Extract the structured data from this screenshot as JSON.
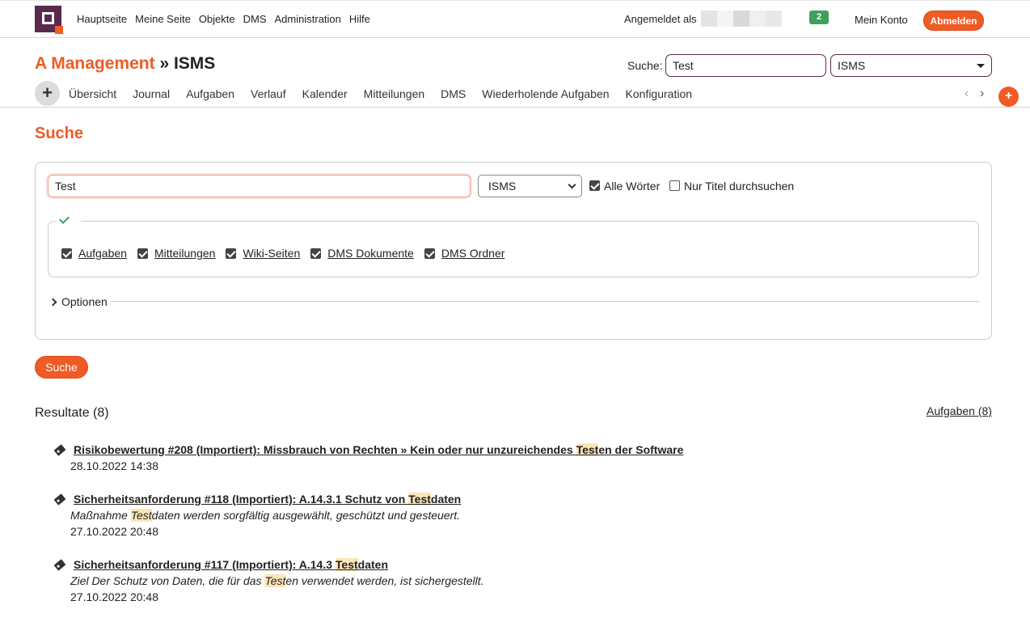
{
  "topbar": {
    "nav": [
      "Hauptseite",
      "Meine Seite",
      "Objekte",
      "DMS",
      "Administration",
      "Hilfe"
    ],
    "logged_in_label": "Angemeldet als",
    "badge_count": "2",
    "account_label": "Mein Konto",
    "logout_label": "Abmelden"
  },
  "header": {
    "project": "A Management",
    "separator": "»",
    "subproject": "ISMS",
    "search_label": "Suche:",
    "search_value": "Test",
    "scope_value": "ISMS"
  },
  "tabs": [
    "Übersicht",
    "Journal",
    "Aufgaben",
    "Verlauf",
    "Kalender",
    "Mitteilungen",
    "DMS",
    "Wiederholende Aufgaben",
    "Konfiguration"
  ],
  "page": {
    "title": "Suche",
    "query": "Test",
    "scope": "ISMS",
    "all_words_label": "Alle Wörter",
    "all_words_checked": true,
    "titles_only_label": "Nur Titel durchsuchen",
    "titles_only_checked": false,
    "types": [
      {
        "label": "Aufgaben",
        "checked": true
      },
      {
        "label": "Mitteilungen",
        "checked": true
      },
      {
        "label": "Wiki-Seiten",
        "checked": true
      },
      {
        "label": "DMS Dokumente",
        "checked": true
      },
      {
        "label": "DMS Ordner",
        "checked": true
      }
    ],
    "options_label": "Optionen",
    "search_button": "Suche"
  },
  "results": {
    "heading": "Resultate (8)",
    "filter_link": "Aufgaben (8)",
    "items": [
      {
        "title_pre": "Risikobewertung #208 (Importiert): Missbrauch von Rechten » Kein oder nur unzureichendes ",
        "title_hl": "Test",
        "title_post": "en der Software",
        "desc_pre": "",
        "desc_hl": "",
        "desc_post": "",
        "date": "28.10.2022 14:38"
      },
      {
        "title_pre": "Sicherheitsanforderung #118 (Importiert): A.14.3.1 Schutz von ",
        "title_hl": "Test",
        "title_post": "daten",
        "desc_pre": "Maßnahme ",
        "desc_hl": "Test",
        "desc_post": "daten werden sorgfältig ausgewählt, geschützt und gesteuert.",
        "date": "27.10.2022 20:48"
      },
      {
        "title_pre": "Sicherheitsanforderung #117 (Importiert): A.14.3 ",
        "title_hl": "Test",
        "title_post": "daten",
        "desc_pre": "Ziel Der Schutz von Daten, die für das ",
        "desc_hl": "Test",
        "desc_post": "en verwendet werden, ist sichergestellt.",
        "date": "27.10.2022 20:48"
      }
    ]
  }
}
